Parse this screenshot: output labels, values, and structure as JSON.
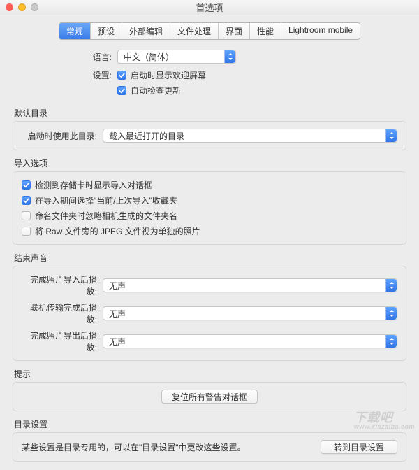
{
  "window": {
    "title": "首选项"
  },
  "tabs": [
    "常规",
    "预设",
    "外部编辑",
    "文件处理",
    "界面",
    "性能",
    "Lightroom mobile"
  ],
  "active_tab": 0,
  "language": {
    "label": "语言:",
    "value": "中文（简体）"
  },
  "settings": {
    "label": "设置:",
    "items": [
      {
        "label": "启动时显示欢迎屏幕",
        "checked": true
      },
      {
        "label": "自动检查更新",
        "checked": true
      }
    ]
  },
  "default_catalog": {
    "section": "默认目录",
    "label": "启动时使用此目录:",
    "value": "载入最近打开的目录"
  },
  "import_options": {
    "section": "导入选项",
    "items": [
      {
        "label": "检测到存储卡时显示导入对话框",
        "checked": true
      },
      {
        "label": "在导入期间选择\"当前/上次导入\"收藏夹",
        "checked": true
      },
      {
        "label": "命名文件夹时忽略相机生成的文件夹名",
        "checked": false
      },
      {
        "label": "将 Raw 文件旁的 JPEG 文件视为单独的照片",
        "checked": false
      }
    ]
  },
  "completion_sounds": {
    "section": "结束声音",
    "rows": [
      {
        "label": "完成照片导入后播放:",
        "value": "无声"
      },
      {
        "label": "联机传输完成后播放:",
        "value": "无声"
      },
      {
        "label": "完成照片导出后播放:",
        "value": "无声"
      }
    ]
  },
  "prompts": {
    "section": "提示",
    "button": "复位所有警告对话框"
  },
  "catalog_settings": {
    "section": "目录设置",
    "text": "某些设置是目录专用的，可以在\"目录设置\"中更改这些设置。",
    "button": "转到目录设置"
  },
  "watermark": {
    "main": "下载吧",
    "sub": "www.xiazaiba.com"
  }
}
